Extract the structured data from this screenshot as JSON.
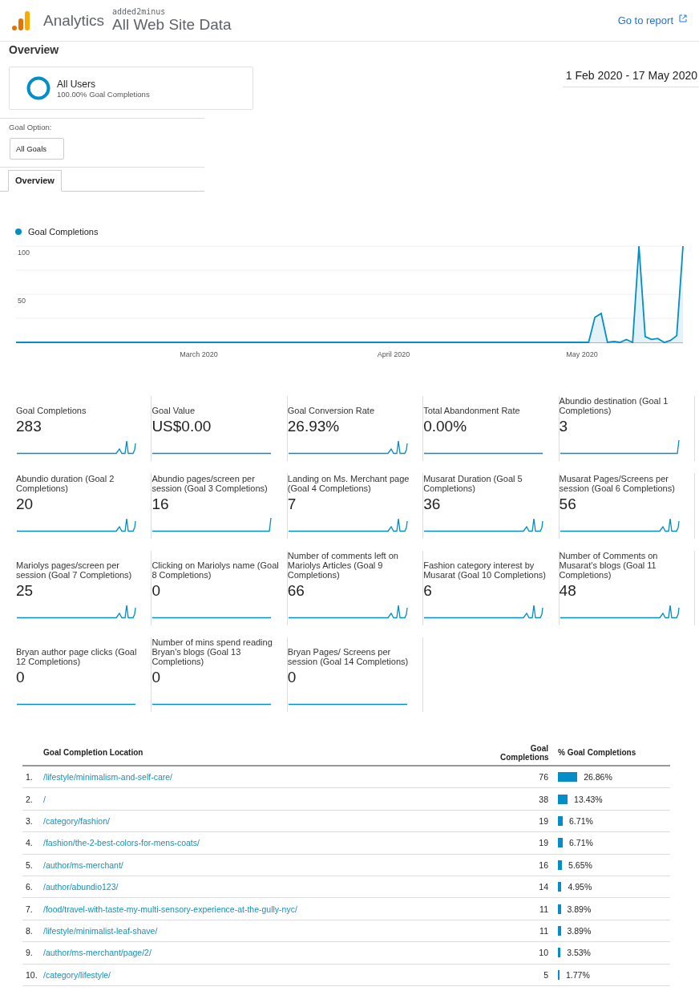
{
  "header": {
    "product": "Analytics",
    "account": "added2minus",
    "property": "All Web Site Data",
    "report_link": "Go to report"
  },
  "page_title": "Overview",
  "segment": {
    "name": "All Users",
    "detail": "100.00% Goal Completions"
  },
  "date_range": "1 Feb 2020 - 17 May 2020",
  "goal_option": {
    "label": "Goal Option:",
    "value": "All Goals"
  },
  "tabs": [
    {
      "label": "Overview",
      "selected": true
    }
  ],
  "chart": {
    "month_labels": [
      "March 2020",
      "April 2020",
      "May 2020"
    ],
    "chart_data": {
      "type": "line",
      "ylim": [
        0,
        100
      ],
      "yticks": [
        50,
        100
      ],
      "series": [
        {
          "name": "Goal Completions",
          "color": "#058dc7",
          "values": [
            0,
            0,
            0,
            0,
            0,
            0,
            0,
            0,
            0,
            0,
            0,
            0,
            0,
            0,
            0,
            0,
            0,
            0,
            0,
            0,
            0,
            0,
            0,
            0,
            0,
            0,
            0,
            0,
            0,
            0,
            0,
            0,
            0,
            0,
            0,
            0,
            0,
            0,
            0,
            0,
            0,
            0,
            0,
            0,
            0,
            0,
            0,
            0,
            0,
            0,
            0,
            0,
            0,
            0,
            0,
            0,
            0,
            0,
            0,
            0,
            0,
            0,
            0,
            0,
            0,
            0,
            0,
            0,
            0,
            0,
            0,
            0,
            0,
            0,
            0,
            0,
            0,
            0,
            0,
            0,
            0,
            0,
            0,
            0,
            0,
            0,
            0,
            0,
            0,
            0,
            0,
            0,
            26,
            30,
            0,
            1,
            0,
            3,
            0,
            100,
            6,
            3,
            4,
            0,
            2,
            7,
            100
          ]
        }
      ]
    }
  },
  "metrics": [
    {
      "label": "Goal Completions",
      "value": "283"
    },
    {
      "label": "Goal Value",
      "value": "US$0.00"
    },
    {
      "label": "Goal Conversion Rate",
      "value": "26.93%"
    },
    {
      "label": "Total Abandonment Rate",
      "value": "0.00%"
    },
    {
      "label": "Abundio destination (Goal 1 Completions)",
      "value": "3"
    },
    {
      "label": "Abundio duration (Goal 2 Completions)",
      "value": "20"
    },
    {
      "label": "Abundio pages/screen per session (Goal 3 Completions)",
      "value": "16"
    },
    {
      "label": "Landing on Ms. Merchant page (Goal 4 Completions)",
      "value": "7"
    },
    {
      "label": "Musarat Duration (Goal 5 Completions)",
      "value": "36"
    },
    {
      "label": "Musarat Pages/Screens per session (Goal 6 Completions)",
      "value": "56"
    },
    {
      "label": "Mariolys pages/screen per session (Goal 7 Completions)",
      "value": "25"
    },
    {
      "label": "Clicking on Mariolys name (Goal 8 Completions)",
      "value": "0"
    },
    {
      "label": "Number of comments left on Mariolys Articles (Goal 9 Completions)",
      "value": "66"
    },
    {
      "label": "Fashion category interest by Musarat (Goal 10 Completions)",
      "value": "6"
    },
    {
      "label": "Number of Comments on Musarat's blogs (Goal 11 Completions)",
      "value": "48"
    },
    {
      "label": "Bryan author page clicks (Goal 12 Completions)",
      "value": "0"
    },
    {
      "label": "Number of mins spend reading Bryan's blogs (Goal 13 Completions)",
      "value": "0"
    },
    {
      "label": "Bryan Pages/ Screens per session (Goal 14 Completions)",
      "value": "0"
    }
  ],
  "table": {
    "columns": [
      "Goal Completion Location",
      "Goal Completions",
      "% Goal Completions"
    ],
    "rows": [
      {
        "index": "1.",
        "location": "/lifestyle/minimalism-and-self-care/",
        "completions": "76",
        "percent": "26.86%"
      },
      {
        "index": "2.",
        "location": "/",
        "completions": "38",
        "percent": "13.43%"
      },
      {
        "index": "3.",
        "location": "/category/fashion/",
        "completions": "19",
        "percent": "6.71%"
      },
      {
        "index": "4.",
        "location": "/fashion/the-2-best-colors-for-mens-coats/",
        "completions": "19",
        "percent": "6.71%"
      },
      {
        "index": "5.",
        "location": "/author/ms-merchant/",
        "completions": "16",
        "percent": "5.65%"
      },
      {
        "index": "6.",
        "location": "/author/abundio123/",
        "completions": "14",
        "percent": "4.95%"
      },
      {
        "index": "7.",
        "location": "/food/travel-with-taste-my-multi-sensory-experience-at-the-gully-nyc/",
        "completions": "11",
        "percent": "3.89%"
      },
      {
        "index": "8.",
        "location": "/lifestyle/minimalist-leaf-shave/",
        "completions": "11",
        "percent": "3.89%"
      },
      {
        "index": "9.",
        "location": "/author/ms-merchant/page/2/",
        "completions": "10",
        "percent": "3.53%"
      },
      {
        "index": "10.",
        "location": "/category/lifestyle/",
        "completions": "5",
        "percent": "1.77%"
      }
    ]
  }
}
